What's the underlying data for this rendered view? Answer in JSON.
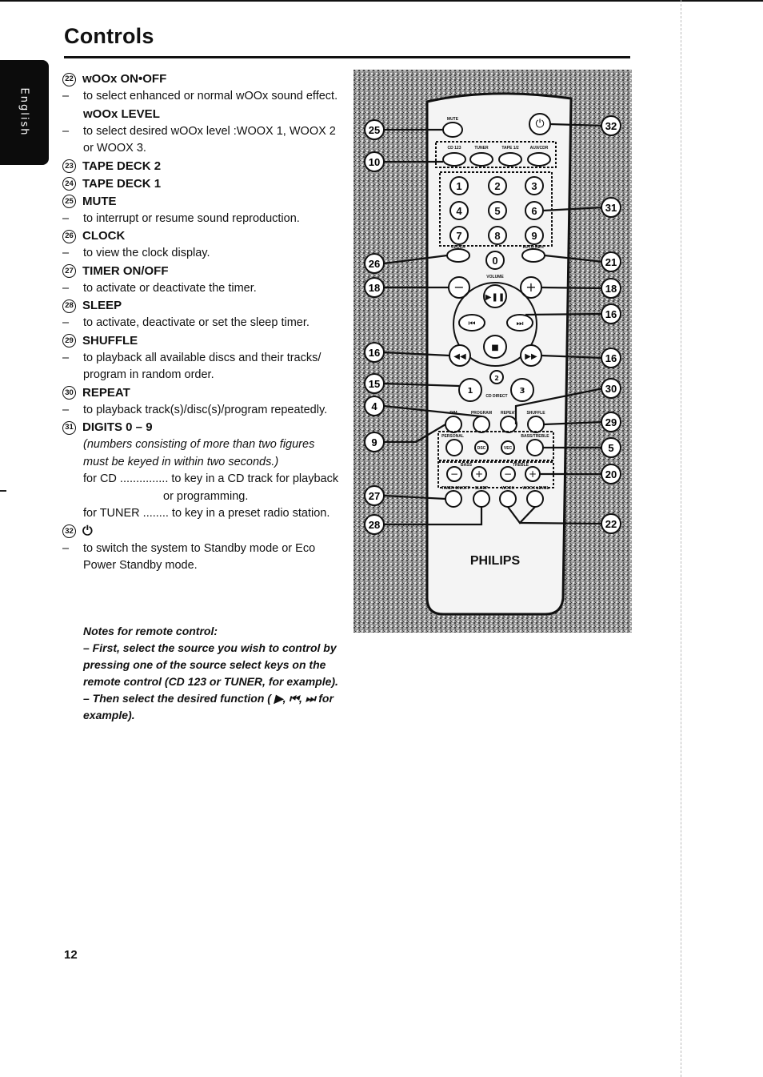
{
  "page": {
    "title": "Controls",
    "language_tab": "English",
    "page_number": "12"
  },
  "items": [
    {
      "num": "22",
      "label": "wOOx ON•OFF",
      "desc": [
        "to select enhanced or normal wOOx sound effect."
      ],
      "sub": {
        "label": "wOOx LEVEL",
        "desc": "to select desired wOOx level :WOOX 1, WOOX 2 or WOOX 3."
      }
    },
    {
      "num": "23",
      "label": "TAPE DECK 2"
    },
    {
      "num": "24",
      "label": "TAPE DECK 1"
    },
    {
      "num": "25",
      "label": "MUTE",
      "desc": [
        "to interrupt or resume sound reproduction."
      ]
    },
    {
      "num": "26",
      "label": "CLOCK",
      "desc": [
        "to view the clock display."
      ]
    },
    {
      "num": "27",
      "label": "TIMER ON/OFF",
      "desc": [
        "to activate or deactivate the timer."
      ]
    },
    {
      "num": "28",
      "label": "SLEEP",
      "desc": [
        "to activate, deactivate or set the sleep timer."
      ]
    },
    {
      "num": "29",
      "label": "SHUFFLE",
      "desc": [
        "to playback all available discs and their tracks/ program in random order."
      ]
    },
    {
      "num": "30",
      "label": "REPEAT",
      "desc": [
        "to playback track(s)/disc(s)/program repeatedly."
      ]
    },
    {
      "num": "31",
      "label": "DIGITS 0 – 9",
      "note": "(numbers consisting of more than two figures must be keyed in within two seconds.)",
      "for_cd": "for CD ............... to key in a CD track for playback",
      "for_cd_cont": "or programming.",
      "for_tuner": "for TUNER ........ to key in a preset radio station."
    },
    {
      "num": "32",
      "label": "⏻",
      "desc": [
        "to switch the system to Standby mode or Eco Power Standby mode."
      ]
    }
  ],
  "notes": {
    "heading": "Notes for remote control:",
    "line1": "– First, select the source you wish to control by pressing one of the source select keys on the remote control (CD 123 or TUNER, for example).",
    "line2": "– Then select the desired function ( ▶, ⏮, ⏭ for example)."
  },
  "remote": {
    "brand": "PHILIPS",
    "labels": {
      "mute": "MUTE",
      "cd": "CD 123",
      "tuner": "TUNER",
      "tape": "TAPE 1/2",
      "aux": "AUX/CDR",
      "clock": "CLOCK",
      "autorev": "AUTO REV.",
      "volume": "VOLUME",
      "cd_direct": "CD DIRECT",
      "dim": "DIM",
      "program": "PROGRAM",
      "repeat": "REPEAT",
      "shuffle": "SHUFFLE",
      "personal": "PERSONAL",
      "dsc": "DSC",
      "vec": "VEC",
      "bass_treble": "BASS/TREBLE",
      "bass": "BASS",
      "treble": "TREBLE",
      "timer": "TIMER ON/OFF",
      "sleep": "SLEEP",
      "woox": "WOOX",
      "woox_level": "WOOX LEVEL"
    },
    "digits": [
      "1",
      "2",
      "3",
      "4",
      "5",
      "6",
      "7",
      "8",
      "9",
      "0"
    ],
    "callouts_left": [
      "25",
      "10",
      "26",
      "18",
      "16",
      "15",
      "4",
      "9",
      "27",
      "28"
    ],
    "callouts_right": [
      "32",
      "31",
      "21",
      "18",
      "16",
      "16",
      "30",
      "29",
      "5",
      "20",
      "22"
    ]
  }
}
